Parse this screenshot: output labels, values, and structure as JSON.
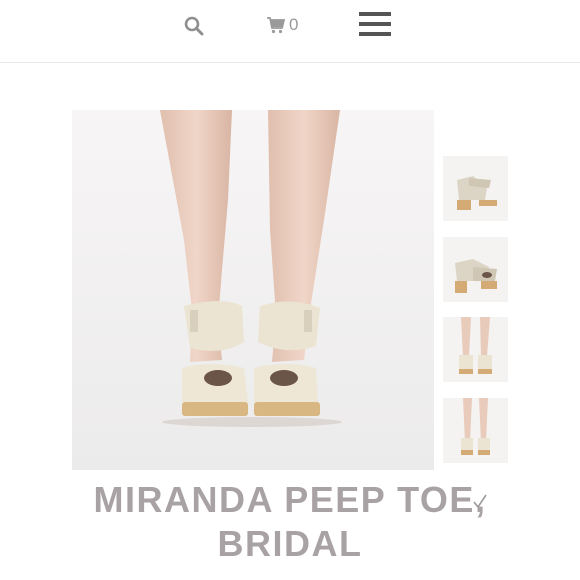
{
  "header": {
    "search_icon": "search-icon",
    "cart_icon": "cart-icon",
    "cart_count": "0",
    "menu_icon": "hamburger-menu-icon"
  },
  "product": {
    "title_line1": "MIRANDA PEEP TOE,",
    "title_line2": "BRIDAL",
    "thumbnails": [
      "side view",
      "side view angled",
      "front view",
      "front view full legs"
    ]
  },
  "colors": {
    "title": "#a9a2a5",
    "icons": "#9a9a9a",
    "menu": "#555555",
    "divider": "#e9e9e9"
  }
}
